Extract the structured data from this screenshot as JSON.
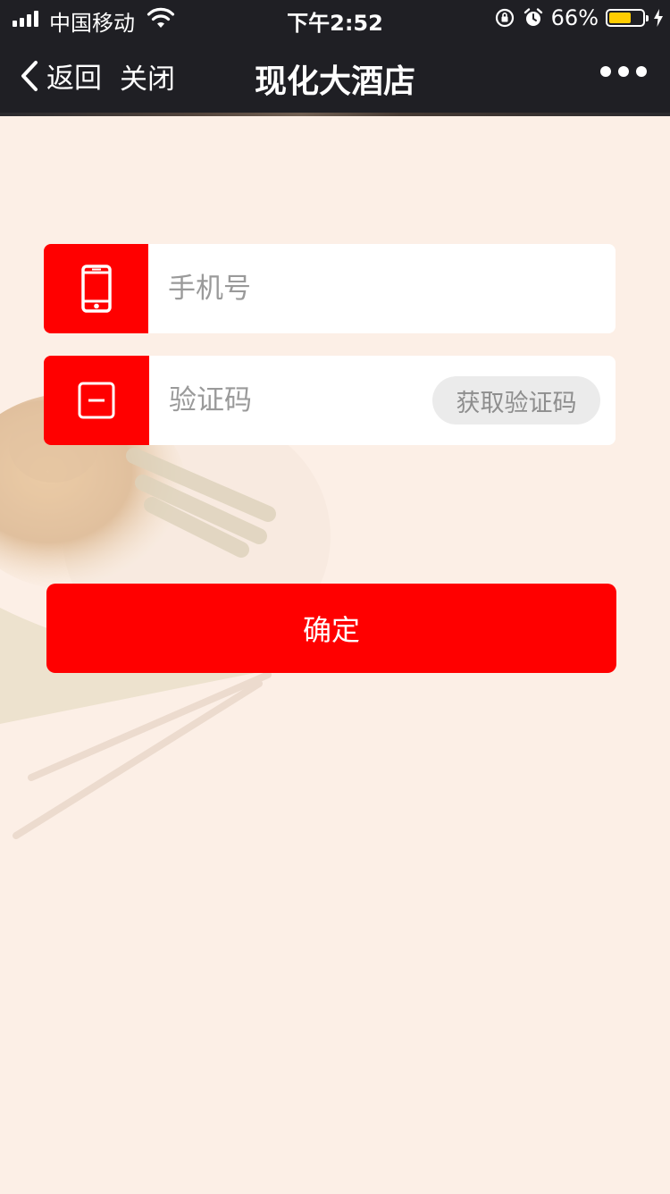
{
  "status_bar": {
    "carrier": "中国移动",
    "time": "下午2:52",
    "battery_percent": "66%",
    "battery_level": 0.66,
    "battery_color": "#ffcc00",
    "icons": [
      "signal-icon",
      "wifi-icon",
      "rotation-lock-icon",
      "alarm-icon",
      "battery-icon",
      "charging-icon"
    ]
  },
  "nav": {
    "back_label": "返回",
    "close_label": "关闭",
    "title": "现化大酒店",
    "more_icon": "more-icon"
  },
  "form": {
    "phone": {
      "placeholder": "手机号",
      "value": "",
      "icon": "phone-icon"
    },
    "code": {
      "placeholder": "验证码",
      "value": "",
      "icon": "code-icon",
      "get_code_label": "获取验证码"
    },
    "confirm_label": "确定"
  },
  "colors": {
    "accent": "#ff0000",
    "background": "#fcefe6",
    "topbar": "#1f1f24"
  }
}
